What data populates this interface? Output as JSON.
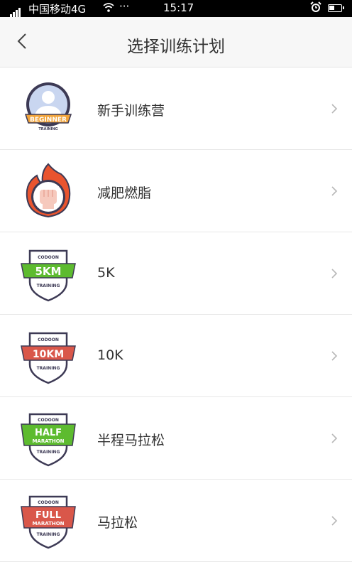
{
  "status_bar": {
    "carrier": "中国移动4G",
    "dots": "···",
    "time": "15:17",
    "icons": [
      "signal-icon",
      "wifi-icon",
      "alarm-icon",
      "battery-icon"
    ]
  },
  "header": {
    "title": "选择训练计划",
    "back_icon": "chevron-left-icon"
  },
  "plans": [
    {
      "label": "新手训练营",
      "badge": {
        "main": "BEGINNER",
        "sub": "TRAINING",
        "color": "#f2a43a"
      }
    },
    {
      "label": "减肥燃脂",
      "badge": {
        "color": "#e9542f"
      }
    },
    {
      "label": "5K",
      "badge": {
        "top": "CODOON",
        "main": "5KM",
        "sub": "TRAINING",
        "color": "#5dbb2f"
      }
    },
    {
      "label": "10K",
      "badge": {
        "top": "CODOON",
        "main": "10KM",
        "sub": "TRAINING",
        "color": "#d9574a"
      }
    },
    {
      "label": "半程马拉松",
      "badge": {
        "top": "CODOON",
        "main": "HALF",
        "main2": "MARATHON",
        "sub": "TRAINING",
        "color": "#5dbb2f"
      }
    },
    {
      "label": "马拉松",
      "badge": {
        "top": "CODOON",
        "main": "FULL",
        "main2": "MARATHON",
        "sub": "TRAINING",
        "color": "#d9574a"
      }
    }
  ],
  "colors": {
    "header_bg": "#f7f7f7",
    "text": "#333333",
    "chevron": "#b8b8b8",
    "divider": "#e8e8e8"
  }
}
